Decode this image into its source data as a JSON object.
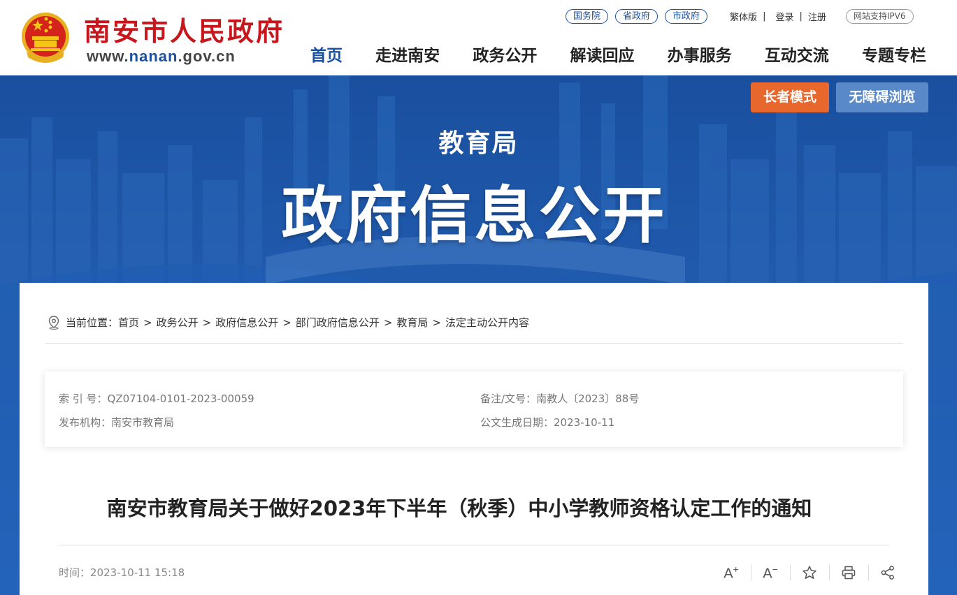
{
  "header": {
    "site_name": "南安市人民政府",
    "site_url_prefix": "www.",
    "site_url_highlight": "nanan",
    "site_url_suffix": ".gov.cn",
    "emblem_icon": "national-emblem-icon",
    "gov_links": [
      "国务院",
      "省政府",
      "市政府"
    ],
    "traditional": "繁体版",
    "login": "登录",
    "register": "注册",
    "separator": "|",
    "ipv6": "网站支持IPV6",
    "nav": [
      "首页",
      "走进南安",
      "政务公开",
      "解读回应",
      "办事服务",
      "互动交流",
      "专题专栏"
    ],
    "active_nav": "首页"
  },
  "banner": {
    "elder_mode": "长者模式",
    "accessible": "无障碍浏览",
    "department": "教育局",
    "title": "政府信息公开"
  },
  "breadcrumb": {
    "label": "当前位置：",
    "items": [
      "首页",
      "政务公开",
      "政府信息公开",
      "部门政府信息公开",
      "教育局",
      "法定主动公开内容"
    ],
    "separator": ">"
  },
  "meta": {
    "index_label": "索 引 号：",
    "index_value": "QZ07104-0101-2023-00059",
    "doc_label": "备注/文号：",
    "doc_value": "南教人〔2023〕88号",
    "publisher_label": "发布机构：",
    "publisher_value": "南安市教育局",
    "date_label": "公文生成日期：",
    "date_value": "2023-10-11"
  },
  "article": {
    "title": "南安市教育局关于做好2023年下半年（秋季）中小学教师资格认定工作的通知",
    "time_label": "时间：",
    "time_value": "2023-10-11 15:18"
  },
  "tools": {
    "font_increase": "A",
    "font_increase_mark": "+",
    "font_decrease": "A",
    "font_decrease_mark": "−"
  },
  "colors": {
    "brand_red": "#c8161d",
    "brand_blue": "#1b4fa0",
    "banner_blue": "#1d5fb8",
    "elder_orange": "#e8672d",
    "access_blue": "#5a89c9"
  }
}
